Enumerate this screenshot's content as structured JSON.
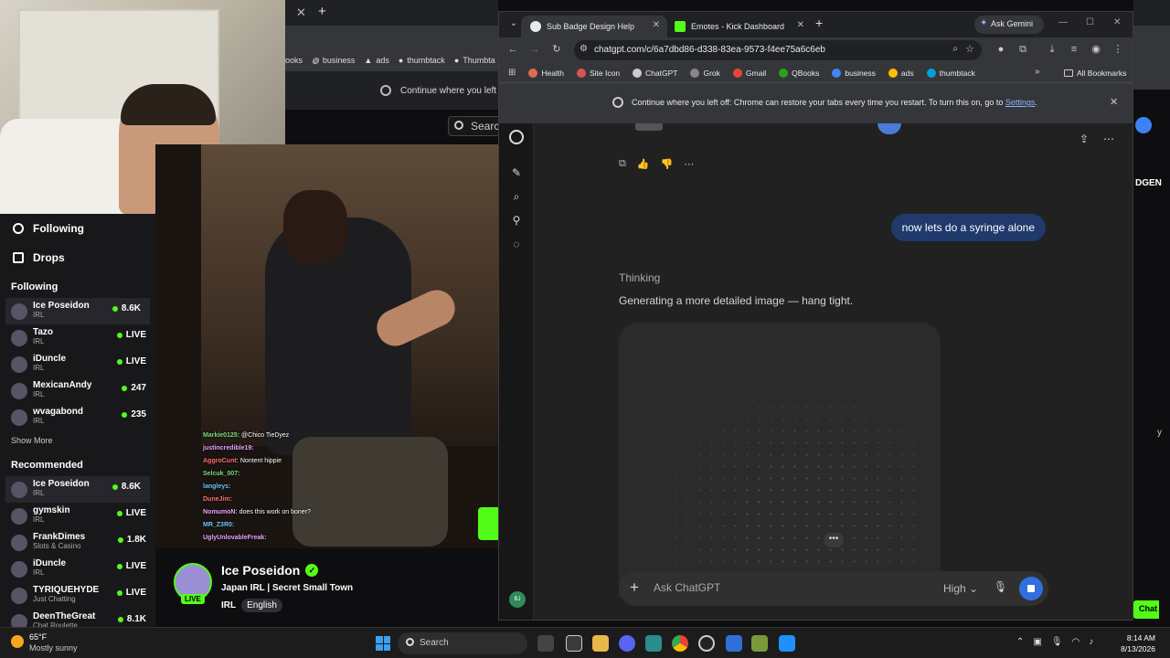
{
  "background_browser": {
    "bookmarks": [
      "ooks",
      "business",
      "ads",
      "thumbtack",
      "Thumbta"
    ],
    "restore_text": "Continue where you left off:",
    "search_label": "Search"
  },
  "kick": {
    "nav": [
      {
        "label": "Following",
        "icon": "heart-icon"
      },
      {
        "label": "Drops",
        "icon": "drops-icon"
      }
    ],
    "following_title": "Following",
    "following": [
      {
        "name": "Ice Poseidon",
        "category": "IRL",
        "viewers": "8.6K",
        "active": true
      },
      {
        "name": "Tazo",
        "category": "IRL",
        "viewers": "LIVE",
        "active": false
      },
      {
        "name": "iDuncle",
        "category": "IRL",
        "viewers": "LIVE",
        "active": false
      },
      {
        "name": "MexicanAndy",
        "category": "IRL",
        "viewers": "247",
        "active": false
      },
      {
        "name": "wvagabond",
        "category": "IRL",
        "viewers": "235",
        "active": false
      }
    ],
    "show_more": "Show More",
    "recommended_title": "Recommended",
    "recommended": [
      {
        "name": "Ice Poseidon",
        "category": "IRL",
        "viewers": "8.6K",
        "active": true
      },
      {
        "name": "gymskin",
        "category": "IRL",
        "viewers": "LIVE",
        "active": false
      },
      {
        "name": "FrankDimes",
        "category": "Slots & Casino",
        "viewers": "1.8K",
        "active": false
      },
      {
        "name": "iDuncle",
        "category": "IRL",
        "viewers": "LIVE",
        "active": false
      },
      {
        "name": "TYRIQUEHYDE",
        "category": "Just Chatting",
        "viewers": "LIVE",
        "active": false
      },
      {
        "name": "DeenTheGreat",
        "category": "Chat Roulette",
        "viewers": "8.1K",
        "active": false
      }
    ],
    "chat_overlay": [
      {
        "user": "Markie0125:",
        "msg": "@Chico TieDyez",
        "cls": "u1"
      },
      {
        "user": "justincredible19:",
        "msg": "",
        "cls": "u2"
      },
      {
        "user": "AggroCunt:",
        "msg": "Nontent hippie",
        "cls": "u3"
      },
      {
        "user": "Selcuk_007:",
        "msg": "",
        "cls": "u1"
      },
      {
        "user": "langleys:",
        "msg": "",
        "cls": "u4"
      },
      {
        "user": "DuneJim:",
        "msg": "",
        "cls": "u3"
      },
      {
        "user": "NomumoN:",
        "msg": "does this work on boner?",
        "cls": "u2"
      },
      {
        "user": "MR_Z3R0:",
        "msg": "",
        "cls": "u4"
      },
      {
        "user": "UglyUnlovableFreak:",
        "msg": "",
        "cls": "u2"
      }
    ],
    "streamer": {
      "name": "Ice Poseidon",
      "live_badge": "LIVE",
      "title": "Japan IRL | Secret Small Town",
      "category": "IRL",
      "language": "English"
    },
    "right_partial": {
      "dgen": "DGEN",
      "chat_button": "Chat",
      "y_char": "y"
    }
  },
  "chatgpt_window": {
    "tabs": [
      {
        "title": "Sub Badge Design Help",
        "active": true
      },
      {
        "title": "Emotes - Kick Dashboard",
        "active": false
      }
    ],
    "ask_gemini": "Ask Gemini",
    "url": "chatgpt.com/c/6a7dbd86-d338-83ea-9573-f4ee75a6c6eb",
    "bookmarks": [
      {
        "label": "Health",
        "color": "#e06c4f"
      },
      {
        "label": "Site Icon",
        "color": "#d9534f"
      },
      {
        "label": "ChatGPT",
        "color": "#cccccc"
      },
      {
        "label": "Grok",
        "color": "#888888"
      },
      {
        "label": "Gmail",
        "color": "#ea4335"
      },
      {
        "label": "QBooks",
        "color": "#2ca01c"
      },
      {
        "label": "business",
        "color": "#4285f4"
      },
      {
        "label": "ads",
        "color": "#fbbc04"
      },
      {
        "label": "thumbtack",
        "color": "#009fd9"
      }
    ],
    "all_bookmarks": "All Bookmarks",
    "restore_text": "Continue where you left off: Chrome can restore your tabs every time you restart. To turn this on, go to",
    "restore_link": "Settings",
    "restore_suffix": ".",
    "conversation": {
      "user_message": "now lets do a syringe alone",
      "thinking": "Thinking",
      "status": "Generating a more detailed image — hang tight.",
      "composer_placeholder": "Ask ChatGPT",
      "model_selector": "High",
      "user_initials": "BJ"
    }
  },
  "taskbar": {
    "temperature": "65°F",
    "condition": "Mostly sunny",
    "search_label": "Search",
    "time": "8:14 AM",
    "date": "8/13/2026"
  },
  "colors": {
    "kick_green": "#53fc18",
    "user_bubble": "#1f3a6b",
    "stop_button": "#2f6fe0"
  }
}
